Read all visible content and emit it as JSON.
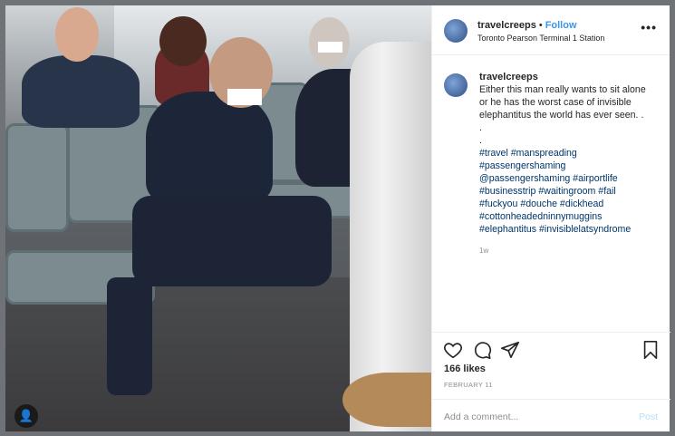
{
  "post": {
    "username": "travelcreeps",
    "separator": "•",
    "follow_label": "Follow",
    "location": "Toronto Pearson Terminal 1 Station",
    "more_label": "•••",
    "caption": "Either this man really wants to sit alone or he has the worst case of invisible elephantitus the world has ever seen. .\n.\n.",
    "hashtags": "#travel #manspreading #passengershaming @passengershaming #airportlife #businesstrip #waitingroom #fail #fuckyou #douche #dickhead #cottonheadedninnymuggins #elephantitus #invisiblelatsyndrome",
    "time_ago": "1w",
    "likes": "166 likes",
    "date": "FEBRUARY 11",
    "comment_placeholder": "Add a comment...",
    "post_label": "Post"
  },
  "icons": [
    "heart-icon",
    "comment-icon",
    "share-icon",
    "bookmark-icon",
    "user-tag-icon"
  ],
  "colors": {
    "link": "#3897f0",
    "hashtag": "#003569",
    "muted": "#8e8e8e"
  }
}
